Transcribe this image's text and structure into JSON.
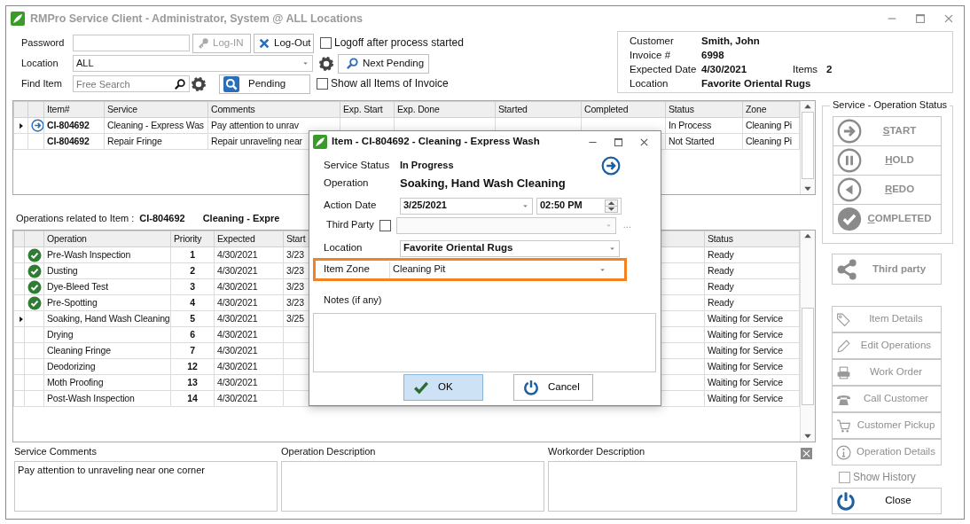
{
  "window": {
    "title": "RMPro Service Client - Administrator, System @ ALL Locations"
  },
  "login": {
    "password_label": "Password",
    "login_button": {
      "label": "Log-IN",
      "disabled": true
    },
    "logout_button": {
      "label": "Log-Out",
      "disabled": false
    },
    "logoff_option": {
      "label": "Logoff after process started",
      "checked": false
    },
    "location_label": "Location",
    "location_value": "ALL",
    "next_pending_button": "Next Pending",
    "find_label": "Find Item",
    "find_placeholder": "Free Search",
    "pending_button": "Pending",
    "show_all_option": {
      "label": "Show all Items of Invoice",
      "checked": false
    }
  },
  "invoice": {
    "rows": [
      {
        "label": "Customer",
        "value": "Smith, John"
      },
      {
        "label": "Invoice #",
        "value": "6998"
      },
      {
        "label": "Expected Date",
        "value": "4/30/2021",
        "extra_label": "Items",
        "extra_value": "2"
      },
      {
        "label": "Location",
        "value": "Favorite Oriental Rugs"
      }
    ]
  },
  "items_table": {
    "columns": [
      "Item#",
      "Service",
      "Comments",
      "Exp. Start",
      "Exp. Done",
      "Started",
      "Completed",
      "Status",
      "Zone"
    ],
    "rows": [
      {
        "current": true,
        "in_process": true,
        "item": "CI-804692",
        "service": "Cleaning - Express Was",
        "comments": "Pay attention to unrav",
        "status": "In Process",
        "zone": "Cleaning Pi"
      },
      {
        "current": false,
        "in_process": false,
        "item": "CI-804692",
        "service": "Repair Fringe",
        "comments": "Repair unraveling near",
        "status": "Not Started",
        "zone": "Cleaning Pi"
      }
    ]
  },
  "operations": {
    "label": "Operations related to Item :",
    "item": "CI-804692",
    "service": "Cleaning - Expre",
    "columns": [
      "Operation",
      "Priority",
      "Expected",
      "Start",
      "Status"
    ],
    "rows": [
      {
        "done": true,
        "current": false,
        "operation": "Pre-Wash Inspection",
        "priority": "1",
        "expected": "4/30/2021",
        "start": "3/23",
        "status": "Ready"
      },
      {
        "done": true,
        "current": false,
        "operation": "Dusting",
        "priority": "2",
        "expected": "4/30/2021",
        "start": "3/23",
        "status": "Ready"
      },
      {
        "done": true,
        "current": false,
        "operation": "Dye-Bleed Test",
        "priority": "3",
        "expected": "4/30/2021",
        "start": "3/23",
        "status": "Ready"
      },
      {
        "done": true,
        "current": false,
        "operation": "Pre-Spotting",
        "priority": "4",
        "expected": "4/30/2021",
        "start": "3/23",
        "status": "Ready"
      },
      {
        "done": false,
        "current": true,
        "operation": "Soaking, Hand Wash Cleaning",
        "priority": "5",
        "expected": "4/30/2021",
        "start": "3/25",
        "status": "Waiting for Service"
      },
      {
        "done": false,
        "current": false,
        "operation": "Drying",
        "priority": "6",
        "expected": "4/30/2021",
        "status": "Waiting for Service"
      },
      {
        "done": false,
        "current": false,
        "operation": "Cleaning Fringe",
        "priority": "7",
        "expected": "4/30/2021",
        "status": "Waiting for Service"
      },
      {
        "done": false,
        "current": false,
        "operation": "Deodorizing",
        "priority": "12",
        "expected": "4/30/2021",
        "status": "Waiting for Service"
      },
      {
        "done": false,
        "current": false,
        "operation": "Moth Proofing",
        "priority": "13",
        "expected": "4/30/2021",
        "status": "Waiting for Service"
      },
      {
        "done": false,
        "current": false,
        "operation": "Post-Wash Inspection",
        "priority": "14",
        "expected": "4/30/2021",
        "status": "Waiting for Service"
      }
    ]
  },
  "bottom_panes": [
    {
      "title": "Service Comments",
      "text": "Pay attention to unraveling near one corner"
    },
    {
      "title": "Operation Description"
    },
    {
      "title": "Workorder Description"
    }
  ],
  "status_panel": {
    "title": "Service - Operation Status",
    "buttons": [
      {
        "kind": "start",
        "label": "START",
        "disabled": true
      },
      {
        "kind": "hold",
        "label": "HOLD",
        "disabled": true
      },
      {
        "kind": "redo",
        "label": "REDO",
        "disabled": true
      },
      {
        "kind": "complete",
        "label": "COMPLETED",
        "disabled": true
      }
    ]
  },
  "third_party_button": {
    "label": "Third party",
    "disabled": true
  },
  "actions": [
    {
      "kind": "tag",
      "label": "Item Details",
      "disabled": true
    },
    {
      "kind": "pencil",
      "label": "Edit Operations",
      "disabled": true
    },
    {
      "kind": "printer",
      "label": "Work Order",
      "disabled": true
    },
    {
      "kind": "phone",
      "label": "Call Customer",
      "disabled": true
    },
    {
      "kind": "cart",
      "label": "Customer Pickup",
      "disabled": true
    },
    {
      "kind": "info",
      "label": "Operation Details",
      "disabled": true
    }
  ],
  "show_history": {
    "label": "Show History",
    "checked": false
  },
  "close_button": "Close",
  "dialog": {
    "title": "Item - CI-804692 - Cleaning - Express Wash",
    "service_status_label": "Service Status",
    "service_status": "In Progress",
    "operation_label": "Operation",
    "operation": "Soaking, Hand Wash Cleaning",
    "action_date_label": "Action Date",
    "action_date": "3/25/2021",
    "action_time": "02:50 PM",
    "third_party_label": "Third Party",
    "third_party_checked": false,
    "third_party_more": "...",
    "location_label": "Location",
    "location": "Favorite Oriental Rugs",
    "zone_label": "Item Zone",
    "zone": "Cleaning Pit",
    "zone_highlighted": true,
    "notes_label": "Notes (if any)",
    "ok_button": "OK",
    "cancel_button": "Cancel"
  }
}
